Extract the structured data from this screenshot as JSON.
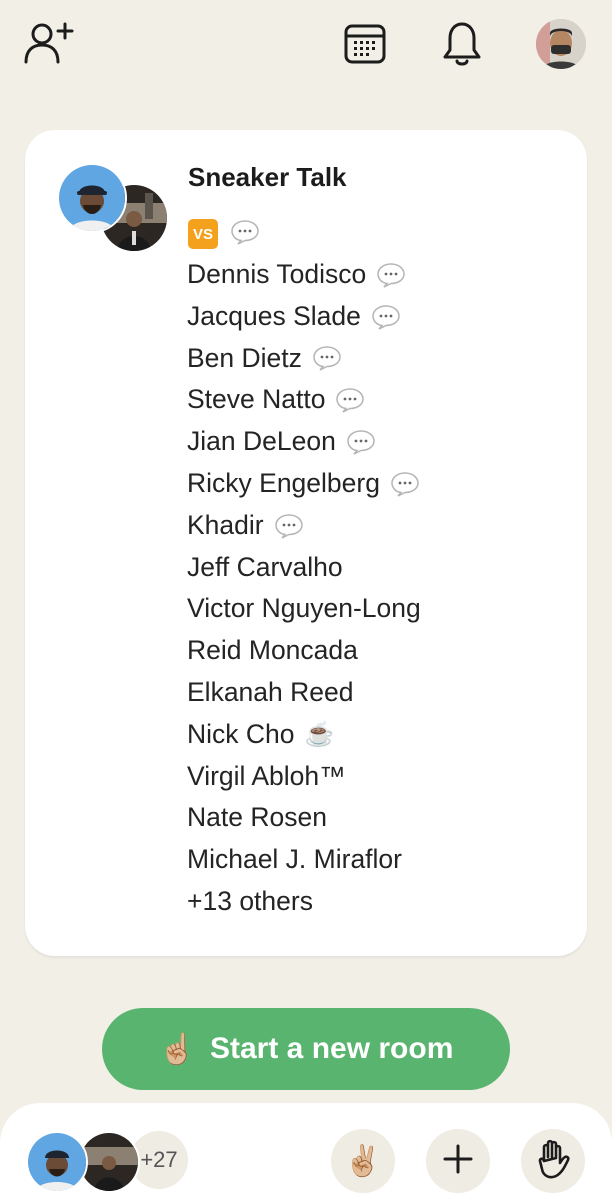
{
  "topbar": {
    "icons": [
      "add-user-icon",
      "calendar-icon",
      "bell-icon",
      "profile-avatar"
    ]
  },
  "room": {
    "title": "Sneaker Talk",
    "badge_text": "VS",
    "speakers": [
      {
        "name": "Dennis Todisco",
        "speaking": true
      },
      {
        "name": "Jacques Slade",
        "speaking": true
      },
      {
        "name": "Ben Dietz",
        "speaking": true
      },
      {
        "name": "Steve Natto",
        "speaking": true
      },
      {
        "name": "Jian DeLeon",
        "speaking": true
      },
      {
        "name": "Ricky Engelberg",
        "speaking": true
      },
      {
        "name": "Khadir",
        "speaking": true
      },
      {
        "name": "Jeff Carvalho",
        "speaking": false
      },
      {
        "name": "Victor Nguyen-Long",
        "speaking": false
      },
      {
        "name": "Reid Moncada",
        "speaking": false
      },
      {
        "name": "Elkanah Reed",
        "speaking": false
      },
      {
        "name": "Nick Cho",
        "speaking": false,
        "emoji": "☕"
      },
      {
        "name": "Virgil Abloh™",
        "speaking": false
      },
      {
        "name": "Nate Rosen",
        "speaking": false
      },
      {
        "name": "Michael J. Miraflor",
        "speaking": false
      }
    ],
    "others": "+13 others"
  },
  "start_room": {
    "emoji": "☝🏼",
    "label": "Start a new room"
  },
  "bottom_bar": {
    "count": "+27",
    "peace_emoji": "✌🏼",
    "colors": {
      "accent": "#58b46e",
      "background": "#f1efe6"
    }
  }
}
